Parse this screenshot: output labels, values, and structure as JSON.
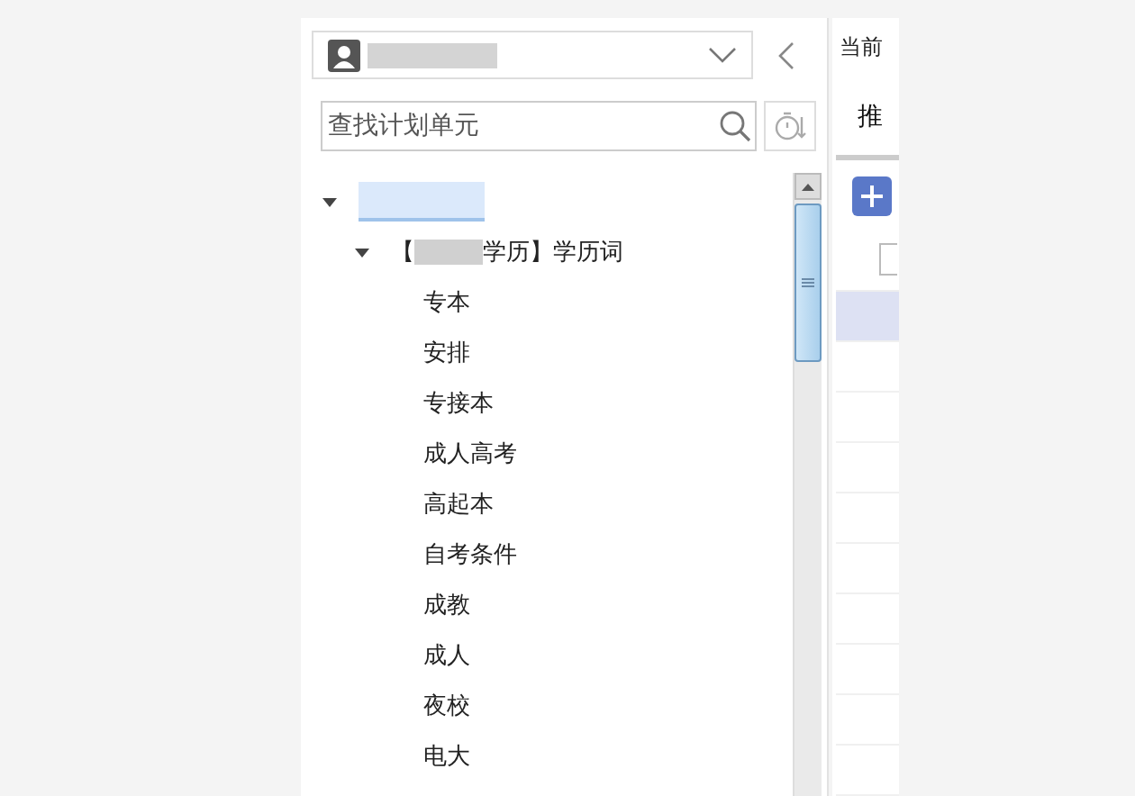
{
  "sidebar": {
    "search": {
      "placeholder": "查找计划单元"
    },
    "tree": [
      {
        "expanded": true,
        "selected": true,
        "children": [
          {
            "label_prefix": "【",
            "label_suffix": "学历】学历词",
            "expanded": true,
            "selected": false,
            "children": [
              {
                "label": "专本",
                "selected": false
              },
              {
                "label": "安排",
                "selected": false
              },
              {
                "label": "专接本",
                "selected": false
              },
              {
                "label": "成人高考",
                "selected": false
              },
              {
                "label": "高起本",
                "selected": false
              },
              {
                "label": "自考条件",
                "selected": false
              },
              {
                "label": "成教",
                "selected": false
              },
              {
                "label": "成人",
                "selected": false
              },
              {
                "label": "夜校",
                "selected": false
              },
              {
                "label": "电大",
                "selected": false
              }
            ]
          }
        ]
      }
    ]
  },
  "main": {
    "breadcrumb": "当前",
    "tabs": [
      {
        "label": "推",
        "selected": true
      }
    ],
    "header_checkbox": {
      "checked": false
    },
    "rows": [
      {
        "selected": true
      },
      {
        "selected": false
      },
      {
        "selected": false
      },
      {
        "selected": false
      },
      {
        "selected": false
      },
      {
        "selected": false
      },
      {
        "selected": false
      },
      {
        "selected": false
      },
      {
        "selected": false
      },
      {
        "selected": false
      }
    ]
  }
}
